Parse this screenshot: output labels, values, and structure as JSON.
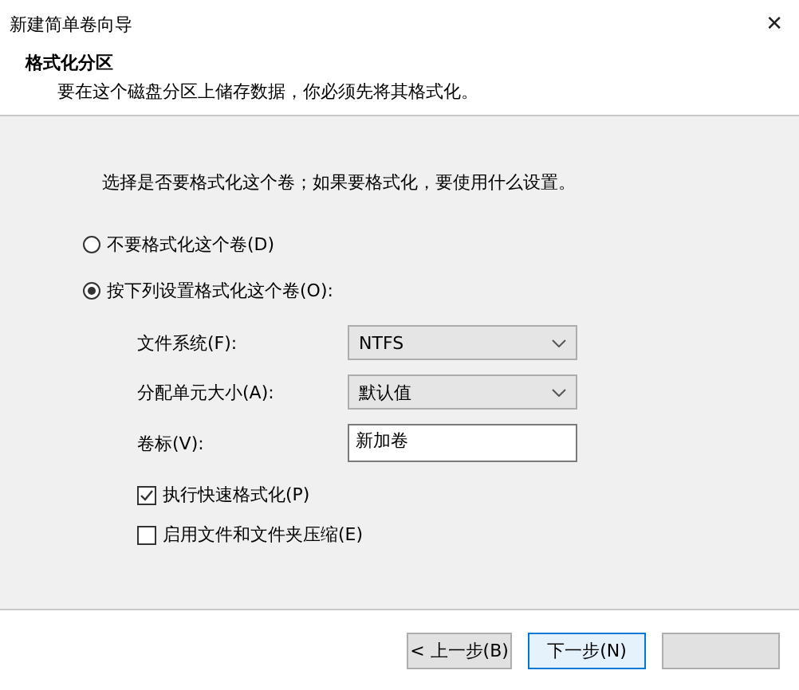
{
  "window": {
    "title": "新建简单卷向导",
    "close": "✕"
  },
  "header": {
    "title": "格式化分区",
    "subtitle": "要在这个磁盘分区上储存数据，你必须先将其格式化。"
  },
  "intro": "选择是否要格式化这个卷；如果要格式化，要使用什么设置。",
  "options": [
    {
      "label": "不要格式化这个卷(D)",
      "selected": false
    },
    {
      "label": "按下列设置格式化这个卷(O):",
      "selected": true
    }
  ],
  "fields": [
    {
      "kind": "select",
      "label": "文件系统(F):",
      "value": "NTFS"
    },
    {
      "kind": "select",
      "label": "分配单元大小(A):",
      "value": "默认值"
    },
    {
      "kind": "text",
      "label": "卷标(V):",
      "value": "新加卷"
    }
  ],
  "checkboxes": [
    {
      "label": "执行快速格式化(P)",
      "checked": true
    },
    {
      "label": "启用文件和文件夹压缩(E)",
      "checked": false
    }
  ],
  "buttons": [
    {
      "label": "< 上一步(B)",
      "focused": false
    },
    {
      "label": "下一步(N)",
      "focused": true
    },
    {
      "focused": false
    }
  ]
}
